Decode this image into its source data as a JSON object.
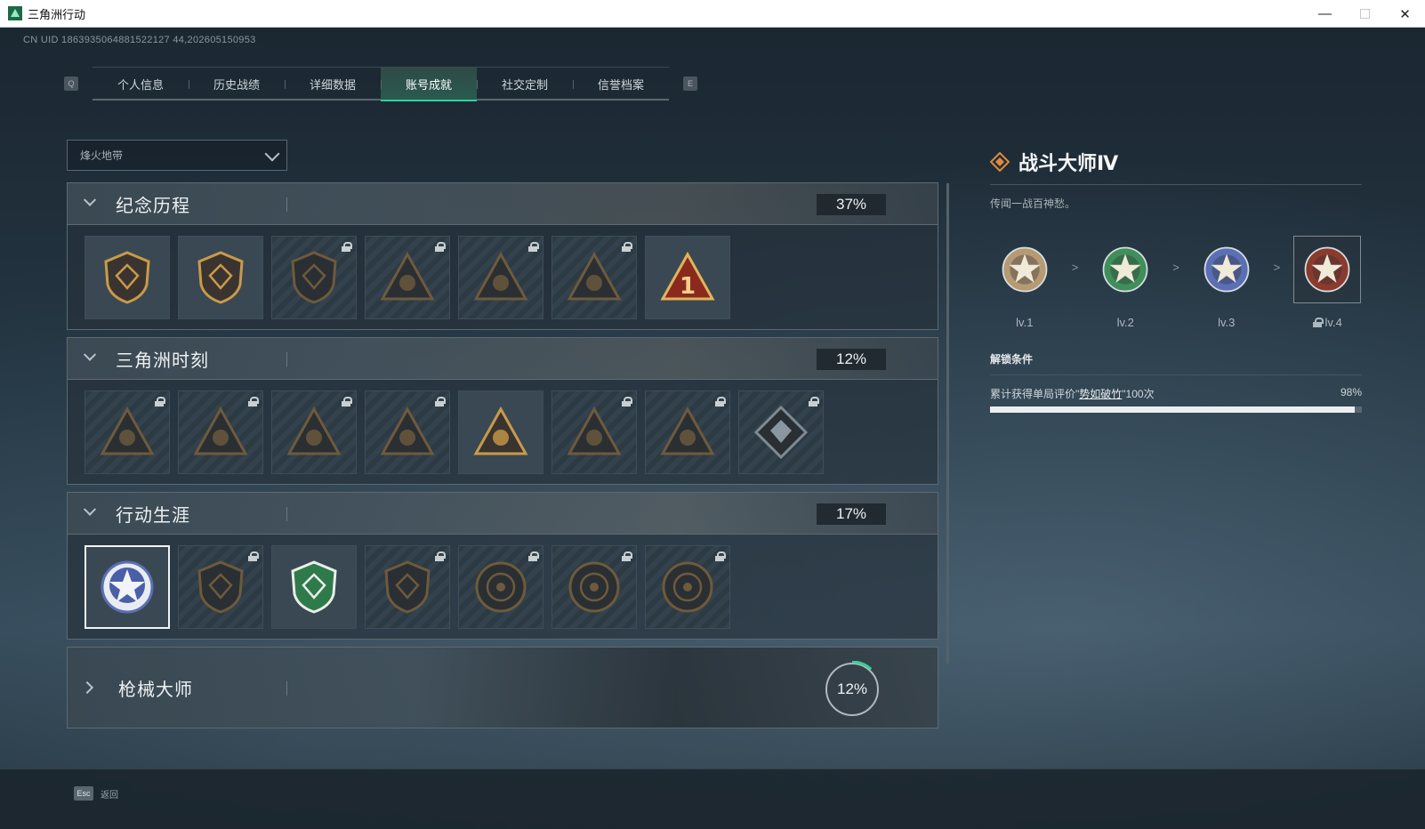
{
  "window": {
    "title": "三角洲行动",
    "minimize": "—",
    "maximize": "☐",
    "close": "✕"
  },
  "uid": "CN UID 1863935064881522127 44,202605150953",
  "tabs": {
    "prev_key": "Q",
    "next_key": "E",
    "items": [
      {
        "label": "个人信息"
      },
      {
        "label": "历史战绩"
      },
      {
        "label": "详细数据"
      },
      {
        "label": "账号成就",
        "active": true
      },
      {
        "label": "社交定制"
      },
      {
        "label": "信誉档案"
      }
    ]
  },
  "mode_select": {
    "value": "烽火地带"
  },
  "sections": [
    {
      "name": "纪念历程",
      "percent": "37%",
      "badges": [
        {
          "icon": "delta-shield-emblem",
          "locked": false
        },
        {
          "icon": "helicopter-shield-emblem",
          "locked": false
        },
        {
          "icon": "mech-shield-emblem",
          "locked": true
        },
        {
          "icon": "soldier-triangle-emblem",
          "locked": true
        },
        {
          "icon": "face-triangle-emblem",
          "locked": true
        },
        {
          "icon": "skull-triangle-emblem",
          "locked": true
        },
        {
          "icon": "number-one-triangle-emblem",
          "locked": false
        }
      ]
    },
    {
      "name": "三角洲时刻",
      "percent": "12%",
      "badges": [
        {
          "icon": "crate-triangle-emblem",
          "locked": true
        },
        {
          "icon": "robot-triangle-emblem",
          "locked": true
        },
        {
          "icon": "diver-triangle-emblem",
          "locked": true
        },
        {
          "icon": "hands-triangle-emblem",
          "locked": true
        },
        {
          "icon": "squad-triangle-emblem",
          "locked": false
        },
        {
          "icon": "team-triangle-emblem",
          "locked": true
        },
        {
          "icon": "grab-triangle-emblem",
          "locked": true
        },
        {
          "icon": "gem-diamond-emblem",
          "locked": true
        }
      ]
    },
    {
      "name": "行动生涯",
      "percent": "17%",
      "badges": [
        {
          "icon": "star-seal-emblem",
          "locked": false,
          "selected": true
        },
        {
          "icon": "wing-shield-emblem",
          "locked": true
        },
        {
          "icon": "green-shield-emblem",
          "locked": false
        },
        {
          "icon": "dice-shield-emblem",
          "locked": true
        },
        {
          "icon": "circle-seal-emblem",
          "locked": true
        },
        {
          "icon": "crosshair-seal-emblem",
          "locked": true
        },
        {
          "icon": "eye-seal-emblem",
          "locked": true
        }
      ]
    }
  ],
  "collapsed_section": {
    "name": "枪械大师",
    "percent": "12%",
    "progress": 0.12
  },
  "detail": {
    "title": "战斗大师Ⅳ",
    "description": "传闻一战百神愁。",
    "levels": [
      {
        "label": "lv.1",
        "color": "#b59a73"
      },
      {
        "label": "lv.2",
        "color": "#3f8f5a"
      },
      {
        "label": "lv.3",
        "color": "#5b6fb5"
      },
      {
        "label": "lv.4",
        "color": "#8a3b2e",
        "locked": true,
        "current": true
      }
    ],
    "arrow": ">",
    "condition_title": "解锁条件",
    "condition_prefix": "累计获得单局评价\"",
    "condition_highlight": "势如破竹",
    "condition_suffix": "\"100次",
    "condition_percent": "98%",
    "condition_progress": 0.98
  },
  "footer": {
    "esc_key": "Esc",
    "esc_label": "返回"
  },
  "colors": {
    "accent": "#2fd39a",
    "gold": "#c99a4a"
  }
}
